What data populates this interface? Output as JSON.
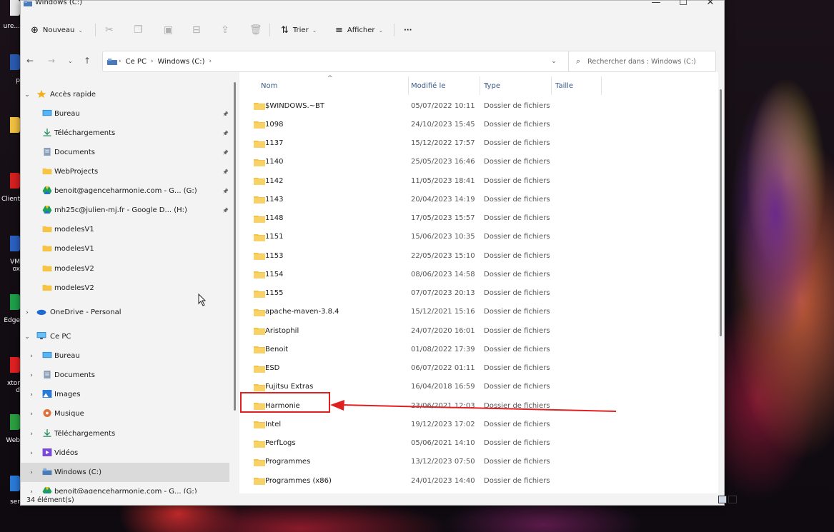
{
  "window": {
    "title": "Windows (C:)",
    "minimize": "—",
    "maximize": "☐",
    "close": "✕"
  },
  "desktop": {
    "icons": [
      {
        "label": "ure...",
        "color": "#e8e8e8"
      },
      {
        "label": "p",
        "color": "#2a5ab0"
      },
      {
        "label": "",
        "color": "#f0c040"
      },
      {
        "label": "Client",
        "color": "#d42020"
      },
      {
        "label": "VM\nox",
        "color": "#2a60c0"
      },
      {
        "label": "Edge",
        "color": "#1ea04a"
      },
      {
        "label": "xtor\nd",
        "color": "#e02020"
      },
      {
        "label": "Web",
        "color": "#2aa040"
      },
      {
        "label": "ser",
        "color": "#2a7ad8"
      }
    ]
  },
  "commandbar": {
    "new_label": "Nouveau",
    "sort_label": "Trier",
    "view_label": "Afficher",
    "more_label": "···"
  },
  "address": {
    "crumbs": [
      "Ce PC",
      "Windows (C:)"
    ],
    "search_placeholder": "Rechercher dans : Windows (C:)"
  },
  "nav": {
    "items": [
      {
        "label": "Accès rapide",
        "level": 0,
        "chev": "⌄",
        "icon": "star",
        "pin": false
      },
      {
        "label": "Bureau",
        "level": 1,
        "chev": "",
        "icon": "desktop",
        "pin": true
      },
      {
        "label": "Téléchargements",
        "level": 1,
        "chev": "",
        "icon": "download",
        "pin": true
      },
      {
        "label": "Documents",
        "level": 1,
        "chev": "",
        "icon": "doc",
        "pin": true
      },
      {
        "label": "WebProjects",
        "level": 1,
        "chev": "",
        "icon": "folder",
        "pin": true
      },
      {
        "label": "benoit@agenceharmonie.com - G... (G:)",
        "level": 1,
        "chev": "",
        "icon": "gdrive",
        "pin": true
      },
      {
        "label": "mh25c@julien-mj.fr - Google D... (H:)",
        "level": 1,
        "chev": "",
        "icon": "gdrive",
        "pin": true
      },
      {
        "label": "modelesV1",
        "level": 1,
        "chev": "",
        "icon": "folder",
        "pin": false
      },
      {
        "label": "modelesV1",
        "level": 1,
        "chev": "",
        "icon": "folder",
        "pin": false
      },
      {
        "label": "modelesV2",
        "level": 1,
        "chev": "",
        "icon": "folder",
        "pin": false
      },
      {
        "label": "modelesV2",
        "level": 1,
        "chev": "",
        "icon": "folder",
        "pin": false
      },
      {
        "label": "OneDrive - Personal",
        "level": 0,
        "chev": "›",
        "icon": "cloud",
        "pin": false
      },
      {
        "label": "Ce PC",
        "level": 0,
        "chev": "⌄",
        "icon": "pc",
        "pin": false
      },
      {
        "label": "Bureau",
        "level": 1,
        "chev": "›",
        "icon": "desktop",
        "pin": false
      },
      {
        "label": "Documents",
        "level": 1,
        "chev": "›",
        "icon": "doc",
        "pin": false
      },
      {
        "label": "Images",
        "level": 1,
        "chev": "›",
        "icon": "image",
        "pin": false
      },
      {
        "label": "Musique",
        "level": 1,
        "chev": "›",
        "icon": "music",
        "pin": false
      },
      {
        "label": "Téléchargements",
        "level": 1,
        "chev": "›",
        "icon": "download",
        "pin": false
      },
      {
        "label": "Vidéos",
        "level": 1,
        "chev": "›",
        "icon": "video",
        "pin": false
      },
      {
        "label": "Windows (C:)",
        "level": 1,
        "chev": "›",
        "icon": "drive",
        "pin": false,
        "selected": true
      },
      {
        "label": "benoit@agenceharmonie.com - G... (G:)",
        "level": 1,
        "chev": "›",
        "icon": "gdrive",
        "pin": false
      }
    ]
  },
  "columns": {
    "name": "Nom",
    "modified": "Modifié le",
    "type": "Type",
    "size": "Taille"
  },
  "files": [
    {
      "name": "$WINDOWS.~BT",
      "date": "05/07/2022 10:11",
      "type": "Dossier de fichiers"
    },
    {
      "name": "1098",
      "date": "24/10/2023 15:45",
      "type": "Dossier de fichiers"
    },
    {
      "name": "1137",
      "date": "15/12/2022 17:57",
      "type": "Dossier de fichiers"
    },
    {
      "name": "1140",
      "date": "25/05/2023 16:46",
      "type": "Dossier de fichiers"
    },
    {
      "name": "1142",
      "date": "11/05/2023 18:41",
      "type": "Dossier de fichiers"
    },
    {
      "name": "1143",
      "date": "20/04/2023 14:19",
      "type": "Dossier de fichiers"
    },
    {
      "name": "1148",
      "date": "17/05/2023 15:57",
      "type": "Dossier de fichiers"
    },
    {
      "name": "1151",
      "date": "15/06/2023 10:35",
      "type": "Dossier de fichiers"
    },
    {
      "name": "1153",
      "date": "22/05/2023 15:10",
      "type": "Dossier de fichiers"
    },
    {
      "name": "1154",
      "date": "08/06/2023 14:58",
      "type": "Dossier de fichiers"
    },
    {
      "name": "1155",
      "date": "07/07/2023 20:13",
      "type": "Dossier de fichiers"
    },
    {
      "name": "apache-maven-3.8.4",
      "date": "15/12/2021 15:16",
      "type": "Dossier de fichiers"
    },
    {
      "name": "Aristophil",
      "date": "24/07/2020 16:01",
      "type": "Dossier de fichiers"
    },
    {
      "name": "Benoit",
      "date": "01/08/2022 17:39",
      "type": "Dossier de fichiers"
    },
    {
      "name": "ESD",
      "date": "06/07/2022 01:11",
      "type": "Dossier de fichiers"
    },
    {
      "name": "Fujitsu Extras",
      "date": "16/04/2018 16:59",
      "type": "Dossier de fichiers"
    },
    {
      "name": "Harmonie",
      "date": "23/06/2021 12:03",
      "type": "Dossier de fichiers"
    },
    {
      "name": "Intel",
      "date": "19/12/2023 17:02",
      "type": "Dossier de fichiers"
    },
    {
      "name": "PerfLogs",
      "date": "05/06/2021 14:10",
      "type": "Dossier de fichiers"
    },
    {
      "name": "Programmes",
      "date": "13/12/2023 07:50",
      "type": "Dossier de fichiers"
    },
    {
      "name": "Programmes (x86)",
      "date": "24/01/2023 14:40",
      "type": "Dossier de fichiers"
    }
  ],
  "status": {
    "count": "34 élément(s)"
  },
  "colors": {
    "folder": "#f6c444",
    "annotation": "#e02020",
    "selection": "#dadada"
  }
}
